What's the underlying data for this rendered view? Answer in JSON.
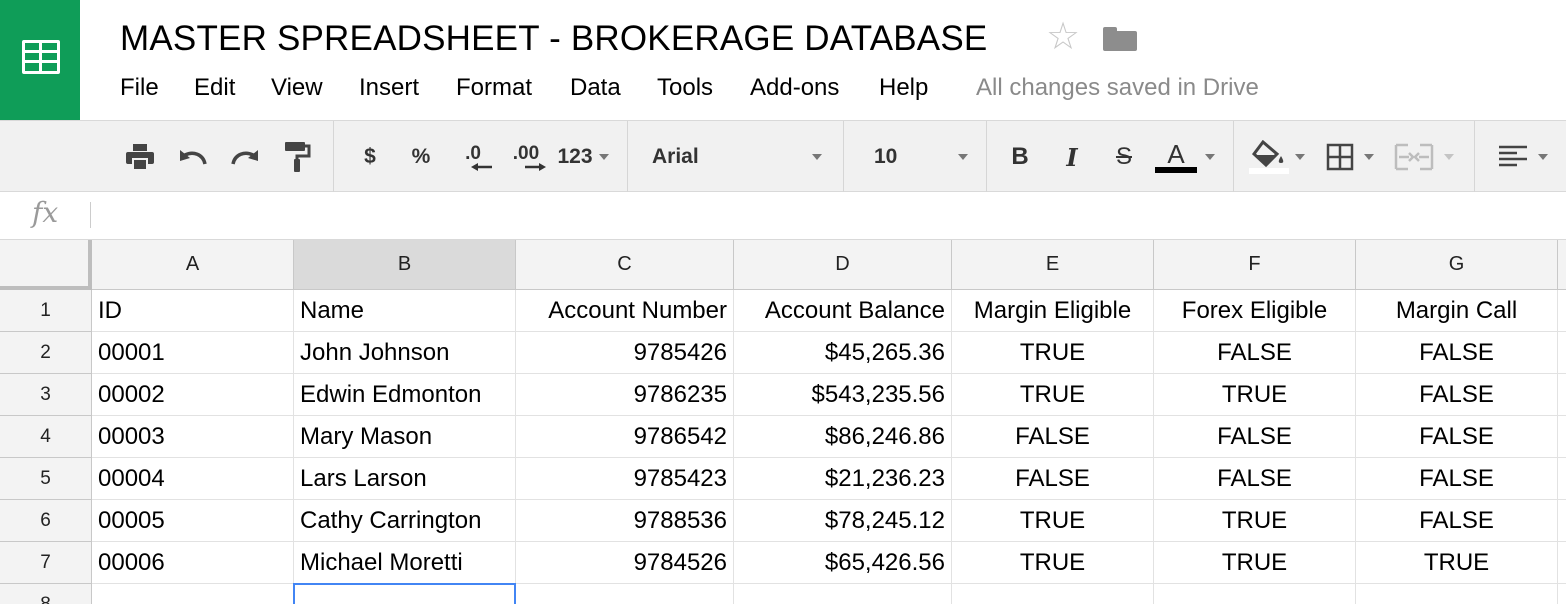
{
  "document": {
    "title": "MASTER SPREADSHEET - BROKERAGE DATABASE",
    "save_status": "All changes saved in Drive"
  },
  "menu": [
    "File",
    "Edit",
    "View",
    "Insert",
    "Format",
    "Data",
    "Tools",
    "Add-ons",
    "Help"
  ],
  "toolbar": {
    "currency": "$",
    "percent": "%",
    "decrease_decimal": ".0",
    "increase_decimal": ".00",
    "more_formats": "123",
    "font": "Arial",
    "font_size": "10",
    "bold": "B",
    "italic": "I",
    "strikethrough": "S",
    "text_color": "A"
  },
  "formula_bar": {
    "label": "fx",
    "value": ""
  },
  "grid": {
    "columns": [
      "A",
      "B",
      "C",
      "D",
      "E",
      "F",
      "G"
    ],
    "row_numbers": [
      "1",
      "2",
      "3",
      "4",
      "5",
      "6",
      "7",
      "8"
    ],
    "rows": [
      [
        "ID",
        "Name",
        "Account Number",
        "Account Balance",
        "Margin Eligible",
        "Forex Eligible",
        "Margin Call"
      ],
      [
        "00001",
        "John Johnson",
        "9785426",
        "$45,265.36",
        "TRUE",
        "FALSE",
        "FALSE"
      ],
      [
        "00002",
        "Edwin Edmonton",
        "9786235",
        "$543,235.56",
        "TRUE",
        "TRUE",
        "FALSE"
      ],
      [
        "00003",
        "Mary Mason",
        "9786542",
        "$86,246.86",
        "FALSE",
        "FALSE",
        "FALSE"
      ],
      [
        "00004",
        "Lars Larson",
        "9785423",
        "$21,236.23",
        "FALSE",
        "FALSE",
        "FALSE"
      ],
      [
        "00005",
        "Cathy Carrington",
        "9788536",
        "$78,245.12",
        "TRUE",
        "TRUE",
        "FALSE"
      ],
      [
        "00006",
        "Michael Moretti",
        "9784526",
        "$65,426.56",
        "TRUE",
        "TRUE",
        "TRUE"
      ],
      [
        "",
        "",
        "",
        "",
        "",
        "",
        ""
      ]
    ],
    "selected_column": "B",
    "active_cell": "B8"
  },
  "colors": {
    "brand": "#0f9d58",
    "selection": "#4285f4",
    "toolbar_bg": "#f1f1f1",
    "header_bg": "#f3f3f3",
    "status_text": "#8a8a8a"
  },
  "icons": [
    "sheets-logo-icon",
    "star-icon",
    "folder-icon",
    "print-icon",
    "undo-icon",
    "redo-icon",
    "paint-format-icon",
    "fill-color-icon",
    "borders-icon",
    "merge-cells-icon",
    "align-left-icon",
    "fx-icon"
  ]
}
